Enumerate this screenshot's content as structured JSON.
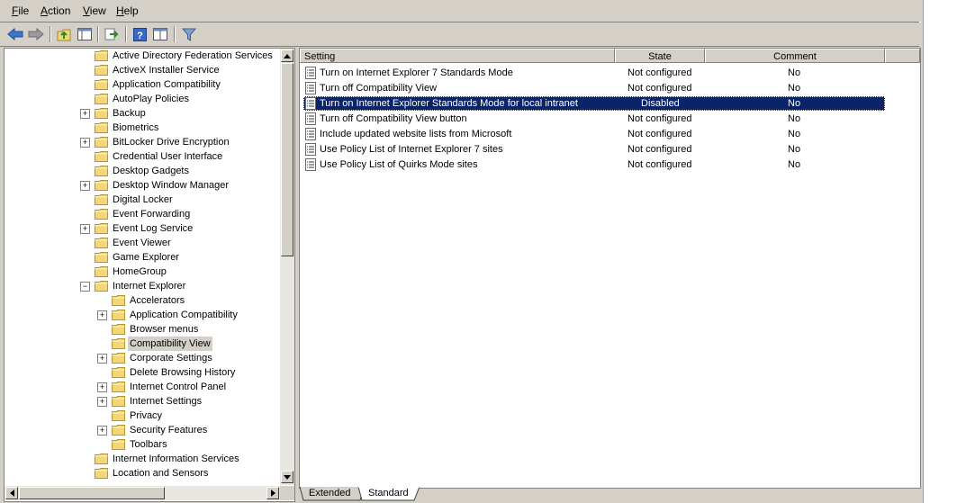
{
  "menubar": {
    "items": [
      {
        "label": "File"
      },
      {
        "label": "Action"
      },
      {
        "label": "View"
      },
      {
        "label": "Help"
      }
    ]
  },
  "toolbar": {
    "buttons": [
      {
        "icon": "back-arrow-icon"
      },
      {
        "icon": "forward-arrow-icon"
      },
      {
        "icon": "up-folder-icon"
      },
      {
        "icon": "show-hide-tree-icon"
      },
      {
        "icon": "export-list-icon"
      },
      {
        "icon": "help-icon"
      },
      {
        "icon": "properties-icon"
      },
      {
        "icon": "filter-icon"
      }
    ]
  },
  "tree": {
    "items": [
      {
        "label": "Active Directory Federation Services",
        "level": 1,
        "expander": ""
      },
      {
        "label": "ActiveX Installer Service",
        "level": 1,
        "expander": ""
      },
      {
        "label": "Application Compatibility",
        "level": 1,
        "expander": ""
      },
      {
        "label": "AutoPlay Policies",
        "level": 1,
        "expander": ""
      },
      {
        "label": "Backup",
        "level": 1,
        "expander": "+"
      },
      {
        "label": "Biometrics",
        "level": 1,
        "expander": ""
      },
      {
        "label": "BitLocker Drive Encryption",
        "level": 1,
        "expander": "+"
      },
      {
        "label": "Credential User Interface",
        "level": 1,
        "expander": ""
      },
      {
        "label": "Desktop Gadgets",
        "level": 1,
        "expander": ""
      },
      {
        "label": "Desktop Window Manager",
        "level": 1,
        "expander": "+"
      },
      {
        "label": "Digital Locker",
        "level": 1,
        "expander": ""
      },
      {
        "label": "Event Forwarding",
        "level": 1,
        "expander": ""
      },
      {
        "label": "Event Log Service",
        "level": 1,
        "expander": "+"
      },
      {
        "label": "Event Viewer",
        "level": 1,
        "expander": ""
      },
      {
        "label": "Game Explorer",
        "level": 1,
        "expander": ""
      },
      {
        "label": "HomeGroup",
        "level": 1,
        "expander": ""
      },
      {
        "label": "Internet Explorer",
        "level": 1,
        "expander": "−"
      },
      {
        "label": "Accelerators",
        "level": 2,
        "expander": ""
      },
      {
        "label": "Application Compatibility",
        "level": 2,
        "expander": "+"
      },
      {
        "label": "Browser menus",
        "level": 2,
        "expander": ""
      },
      {
        "label": "Compatibility View",
        "level": 2,
        "expander": "",
        "selected": true
      },
      {
        "label": "Corporate Settings",
        "level": 2,
        "expander": "+"
      },
      {
        "label": "Delete Browsing History",
        "level": 2,
        "expander": ""
      },
      {
        "label": "Internet Control Panel",
        "level": 2,
        "expander": "+"
      },
      {
        "label": "Internet Settings",
        "level": 2,
        "expander": "+"
      },
      {
        "label": "Privacy",
        "level": 2,
        "expander": ""
      },
      {
        "label": "Security Features",
        "level": 2,
        "expander": "+"
      },
      {
        "label": "Toolbars",
        "level": 2,
        "expander": ""
      },
      {
        "label": "Internet Information Services",
        "level": 1,
        "expander": ""
      },
      {
        "label": "Location and Sensors",
        "level": 1,
        "expander": ""
      }
    ]
  },
  "list": {
    "headers": {
      "setting": "Setting",
      "state": "State",
      "comment": "Comment"
    },
    "rows": [
      {
        "setting": "Turn on Internet Explorer 7 Standards Mode",
        "state": "Not configured",
        "comment": "No"
      },
      {
        "setting": "Turn off Compatibility View",
        "state": "Not configured",
        "comment": "No"
      },
      {
        "setting": "Turn on Internet Explorer Standards Mode for local intranet",
        "state": "Disabled",
        "comment": "No",
        "selected": true
      },
      {
        "setting": "Turn off Compatibility View button",
        "state": "Not configured",
        "comment": "No"
      },
      {
        "setting": "Include updated website lists from Microsoft",
        "state": "Not configured",
        "comment": "No"
      },
      {
        "setting": "Use Policy List of Internet Explorer 7 sites",
        "state": "Not configured",
        "comment": "No"
      },
      {
        "setting": "Use Policy List of Quirks Mode sites",
        "state": "Not configured",
        "comment": "No"
      }
    ]
  },
  "tabs": [
    {
      "label": "Extended"
    },
    {
      "label": "Standard",
      "active": true
    }
  ],
  "colors": {
    "selection": "#0a246a",
    "chrome": "#d4d0c8",
    "folder": "#f2d77a"
  }
}
